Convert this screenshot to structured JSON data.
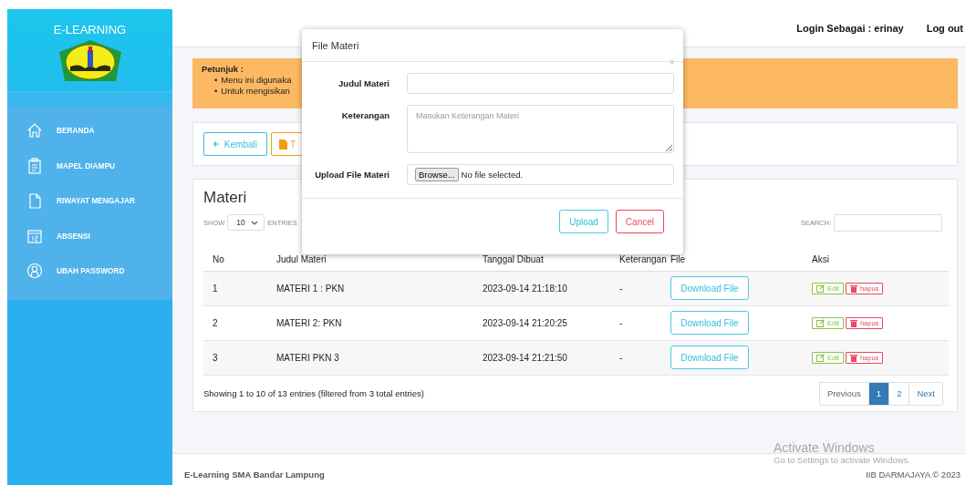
{
  "sidebar": {
    "title": "E-LEARNING",
    "items": [
      {
        "label": "BERANDA"
      },
      {
        "label": "MAPEL DIAMPU"
      },
      {
        "label": "RIWAYAT MENGAJAR"
      },
      {
        "label": "ABSENSI"
      },
      {
        "label": "UBAH PASSWORD"
      }
    ]
  },
  "header": {
    "login": "Login Sebagai : erinay",
    "logout": "Log out"
  },
  "alert": {
    "title": "Petunjuk :",
    "items": [
      {
        "marker": "•",
        "text": "Menu ini digunaka"
      },
      {
        "marker": "•",
        "text": "Untuk mengisikan"
      }
    ]
  },
  "actions": [
    {
      "label": "Kembali",
      "kind": "back"
    },
    {
      "label": "T",
      "kind": "file"
    }
  ],
  "materi": {
    "title": "Materi",
    "show_label": "SHOW",
    "show_value": "10",
    "entries_label": "ENTRIES",
    "search_label": "SEARCH:",
    "columns": [
      "No",
      "Judul Materi",
      "Tanggal Dibuat",
      "Keterangan",
      "File",
      "Aksi"
    ],
    "rows": [
      {
        "no": "1",
        "judul": "MATERI 1 : PKN",
        "tanggal": "2023-09-14 21:18:10",
        "keterangan": "-",
        "file": "Download File",
        "edit": "Edit",
        "hapus": "hapus"
      },
      {
        "no": "2",
        "judul": "MATERI 2: PKN",
        "tanggal": "2023-09-14 21:20:25",
        "keterangan": "-",
        "file": "Download File",
        "edit": "Edit",
        "hapus": "hapus"
      },
      {
        "no": "3",
        "judul": "MATERI PKN 3",
        "tanggal": "2023-09-14 21:21:50",
        "keterangan": "-",
        "file": "Download File",
        "edit": "Edit",
        "hapus": "hapus"
      }
    ],
    "info": "Showing 1 to 10 of 13 entries (filtered from 3 total entries)",
    "pagination": [
      {
        "label": "Previous",
        "selected": false
      },
      {
        "label": "1",
        "selected": true
      },
      {
        "label": "2",
        "selected": false
      },
      {
        "label": "Next",
        "selected": false
      }
    ]
  },
  "footer": {
    "left": "E-Learning SMA Bandar Lampung",
    "right": "IIB DARMAJAYA © 2023"
  },
  "modal": {
    "title": "File Materi",
    "close": "×",
    "fields": [
      {
        "label": "Judul Materi",
        "kind": "text"
      },
      {
        "label": "Keterangan",
        "kind": "textarea",
        "placeholder": "Masukan Keterangan Materi"
      },
      {
        "label": "Upload File Materi",
        "kind": "file",
        "button": "Browse...",
        "value": "No file selected."
      }
    ],
    "buttons": [
      {
        "label": "Upload",
        "kind": "primary"
      },
      {
        "label": "Cancel",
        "kind": "danger"
      }
    ]
  },
  "os_notice": {
    "title": "Activate Windows",
    "text": "Go to Settings to activate Windows."
  }
}
